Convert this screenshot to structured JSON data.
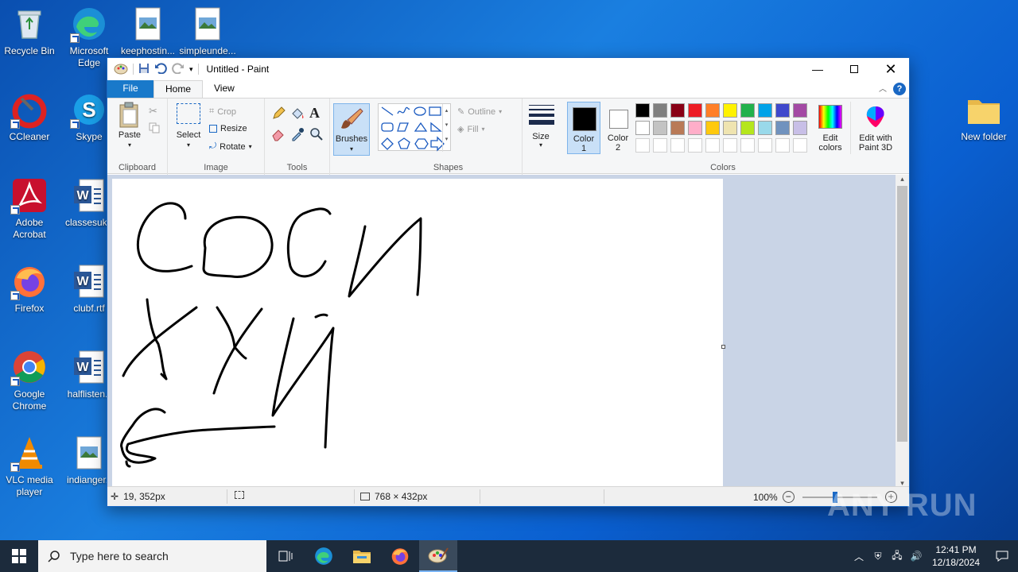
{
  "desktop": {
    "icons": [
      {
        "label": "Recycle Bin"
      },
      {
        "label": "Microsoft Edge"
      },
      {
        "label": "keephostin..."
      },
      {
        "label": "simpleunde..."
      },
      {
        "label": "CCleaner"
      },
      {
        "label": "Skype"
      },
      {
        "label": "Adobe Acrobat"
      },
      {
        "label": "classesuk.r"
      },
      {
        "label": "Firefox"
      },
      {
        "label": "clubf.rtf"
      },
      {
        "label": "Google Chrome"
      },
      {
        "label": "halflisten.r"
      },
      {
        "label": "VLC media player"
      },
      {
        "label": "indianger.r"
      },
      {
        "label": "New folder"
      }
    ]
  },
  "paint": {
    "title": "Untitled - Paint",
    "tabs": {
      "file": "File",
      "home": "Home",
      "view": "View"
    },
    "help": "?",
    "clipboard": {
      "paste": "Paste",
      "label": "Clipboard"
    },
    "image": {
      "select": "Select",
      "crop": "Crop",
      "resize": "Resize",
      "rotate": "Rotate",
      "label": "Image"
    },
    "tools": {
      "label": "Tools"
    },
    "brushes": {
      "label": "Brushes"
    },
    "shapes": {
      "outline": "Outline",
      "fill": "Fill",
      "label": "Shapes"
    },
    "size": {
      "label": "Size"
    },
    "colors": {
      "color1": "Color",
      "color1_num": "1",
      "color2": "Color",
      "color2_num": "2",
      "edit": "Edit colors",
      "edit_l1": "Edit",
      "edit_l2": "colors",
      "paint3d_l1": "Edit with",
      "paint3d_l2": "Paint 3D",
      "label": "Colors",
      "palette_row1": [
        "#000000",
        "#7f7f7f",
        "#880015",
        "#ed1c24",
        "#ff7f27",
        "#fff200",
        "#22b14c",
        "#00a2e8",
        "#3f48cc",
        "#a349a4"
      ],
      "palette_row2": [
        "#ffffff",
        "#c3c3c3",
        "#b97a57",
        "#ffaec9",
        "#ffc90e",
        "#efe4b0",
        "#b5e61d",
        "#99d9ea",
        "#7092be",
        "#c8bfe7"
      ]
    },
    "status": {
      "cursor": "19, 352px",
      "dimensions": "768 × 432px",
      "zoom": "100%"
    }
  },
  "taskbar": {
    "search_placeholder": "Type here to search",
    "time": "12:41 PM",
    "date": "12/18/2024"
  },
  "watermark": "ANY RUN"
}
